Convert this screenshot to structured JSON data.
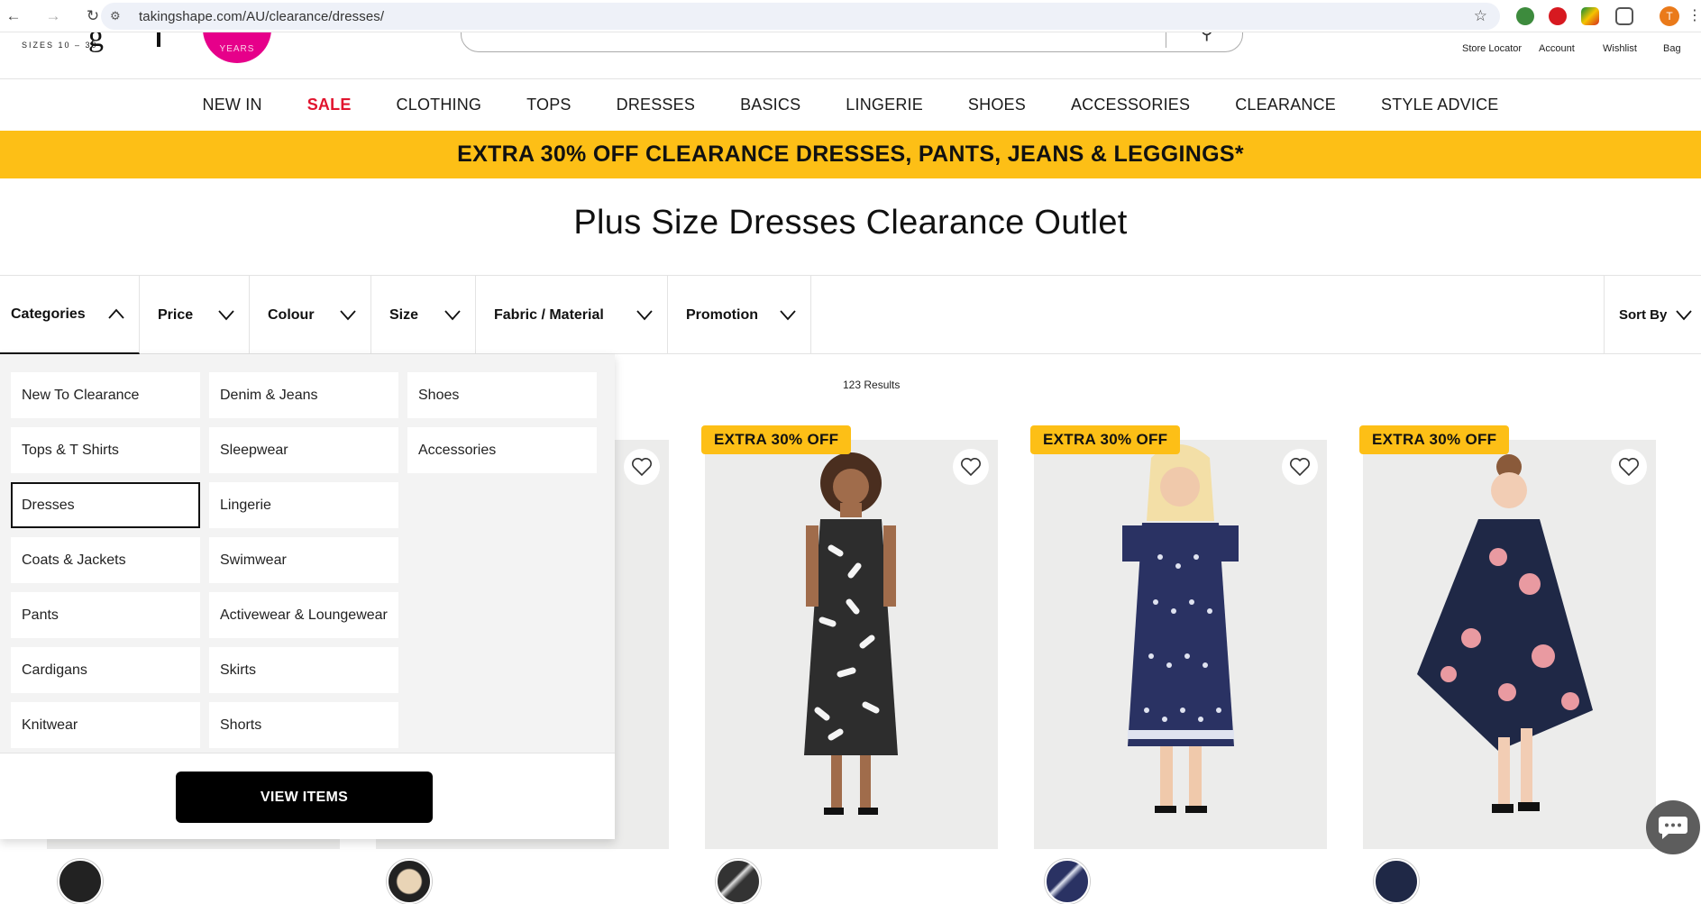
{
  "browser": {
    "url": "takingshape.com/AU/clearance/dresses/",
    "avatar_letter": "T"
  },
  "header": {
    "sizes_text": "SIZES 10 – 30",
    "logo_letter": "g",
    "years_text": "YEARS",
    "links": [
      "Store Locator",
      "Account",
      "Wishlist",
      "Bag"
    ]
  },
  "nav": {
    "items": [
      "NEW IN",
      "SALE",
      "CLOTHING",
      "TOPS",
      "DRESSES",
      "BASICS",
      "LINGERIE",
      "SHOES",
      "ACCESSORIES",
      "CLEARANCE",
      "STYLE ADVICE"
    ]
  },
  "promo": {
    "text": "EXTRA 30% OFF CLEARANCE DRESSES, PANTS, JEANS & LEGGINGS*"
  },
  "page": {
    "title": "Plus Size Dresses Clearance Outlet"
  },
  "filters": {
    "items": [
      "Categories",
      "Price",
      "Colour",
      "Size",
      "Fabric / Material",
      "Promotion"
    ],
    "sort_label": "Sort By"
  },
  "results_text": "123 Results",
  "categories": {
    "col1": [
      "New To Clearance",
      "Tops & T Shirts",
      "Dresses",
      "Coats & Jackets",
      "Pants",
      "Cardigans",
      "Knitwear"
    ],
    "col2": [
      "Denim & Jeans",
      "Sleepwear",
      "Lingerie",
      "Swimwear",
      "Activewear & Loungewear",
      "Skirts",
      "Shorts"
    ],
    "col3": [
      "Shoes",
      "Accessories"
    ],
    "selected": "Dresses",
    "view_button": "VIEW ITEMS"
  },
  "products": [
    {
      "badge": "",
      "bg": "#ececeb"
    },
    {
      "badge": "",
      "bg": "#ececeb"
    },
    {
      "badge": "EXTRA 30% OFF",
      "dress_color": "#2d2d2d",
      "pattern": "#f5f5f5"
    },
    {
      "badge": "EXTRA 30% OFF",
      "dress_color": "#2a3263",
      "pattern": "#dfe3f0"
    },
    {
      "badge": "EXTRA 30% OFF",
      "dress_color": "#1f2846",
      "pattern": "#e99aa1"
    }
  ],
  "colors": {
    "accent_yellow": "#fdbf16",
    "sale_red": "#e1142e",
    "pink_badge": "#e6008a"
  }
}
